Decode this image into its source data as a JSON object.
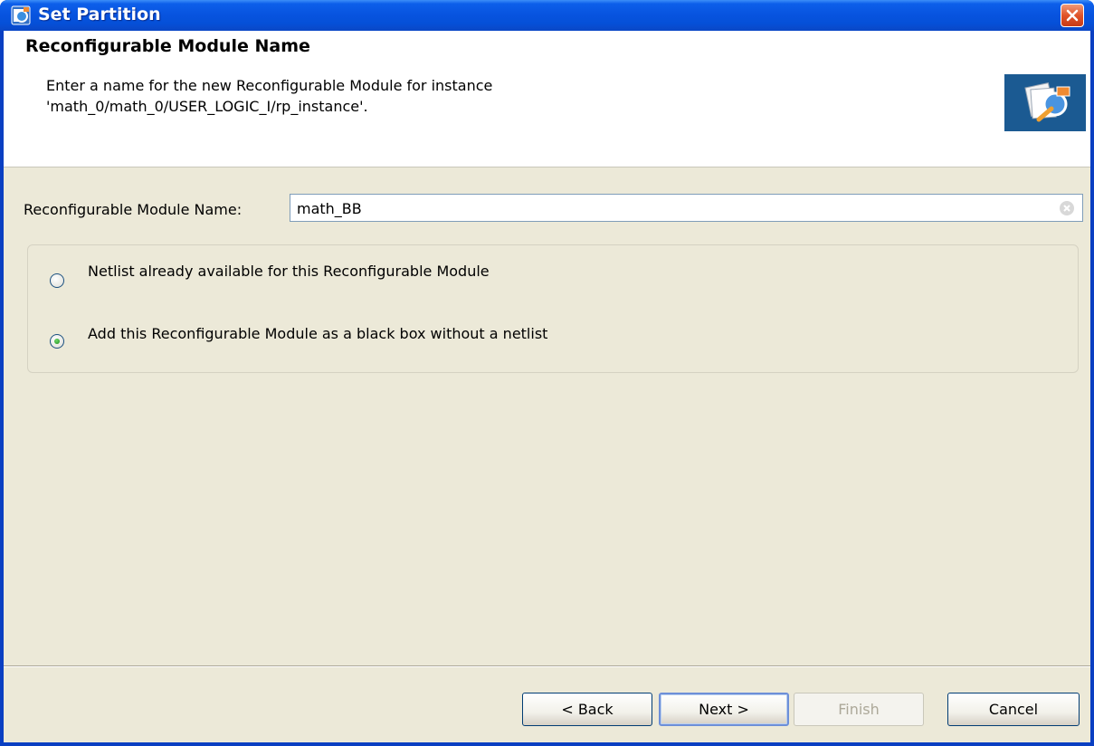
{
  "window": {
    "title": "Set Partition",
    "accent_color": "#0a4fd4",
    "close_icon": "close-icon"
  },
  "header": {
    "title": "Reconfigurable Module Name",
    "description_line1": "Enter a name for the new Reconfigurable Module for instance",
    "description_line2": "'math_0/math_0/USER_LOGIC_I/rp_instance'.",
    "icon": "wizard-banner-icon"
  },
  "form": {
    "name_label": "Reconfigurable Module Name:",
    "name_value": "math_BB",
    "clear_icon": "clear-icon"
  },
  "options": [
    {
      "label": "Netlist already available for this Reconfigurable Module",
      "selected": false
    },
    {
      "label": "Add this Reconfigurable Module as a black box without a netlist",
      "selected": true
    }
  ],
  "buttons": {
    "back": "< Back",
    "next": "Next >",
    "finish": "Finish",
    "cancel": "Cancel"
  }
}
